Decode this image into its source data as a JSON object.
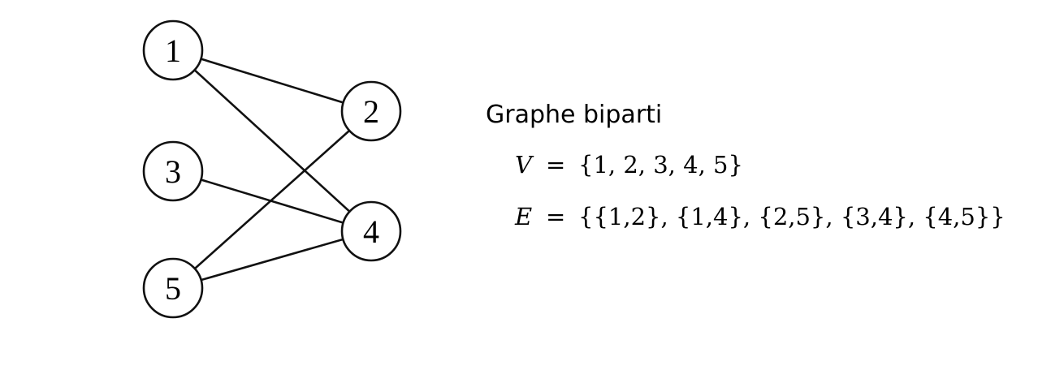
{
  "diagram": {
    "title": "Graphe biparti",
    "nodes": [
      {
        "id": "1",
        "label": "1"
      },
      {
        "id": "2",
        "label": "2"
      },
      {
        "id": "3",
        "label": "3"
      },
      {
        "id": "4",
        "label": "4"
      },
      {
        "id": "5",
        "label": "5"
      }
    ],
    "edges": [
      [
        "1",
        "2"
      ],
      [
        "1",
        "4"
      ],
      [
        "2",
        "5"
      ],
      [
        "3",
        "4"
      ],
      [
        "4",
        "5"
      ]
    ],
    "equations": {
      "v_var": "V",
      "v_op": "=",
      "v_val": "{1, 2, 3, 4, 5}",
      "e_var": "E",
      "e_op": "=",
      "e_val": "{{1,2}, {1,4}, {2,5}, {3,4}, {4,5}}"
    }
  }
}
